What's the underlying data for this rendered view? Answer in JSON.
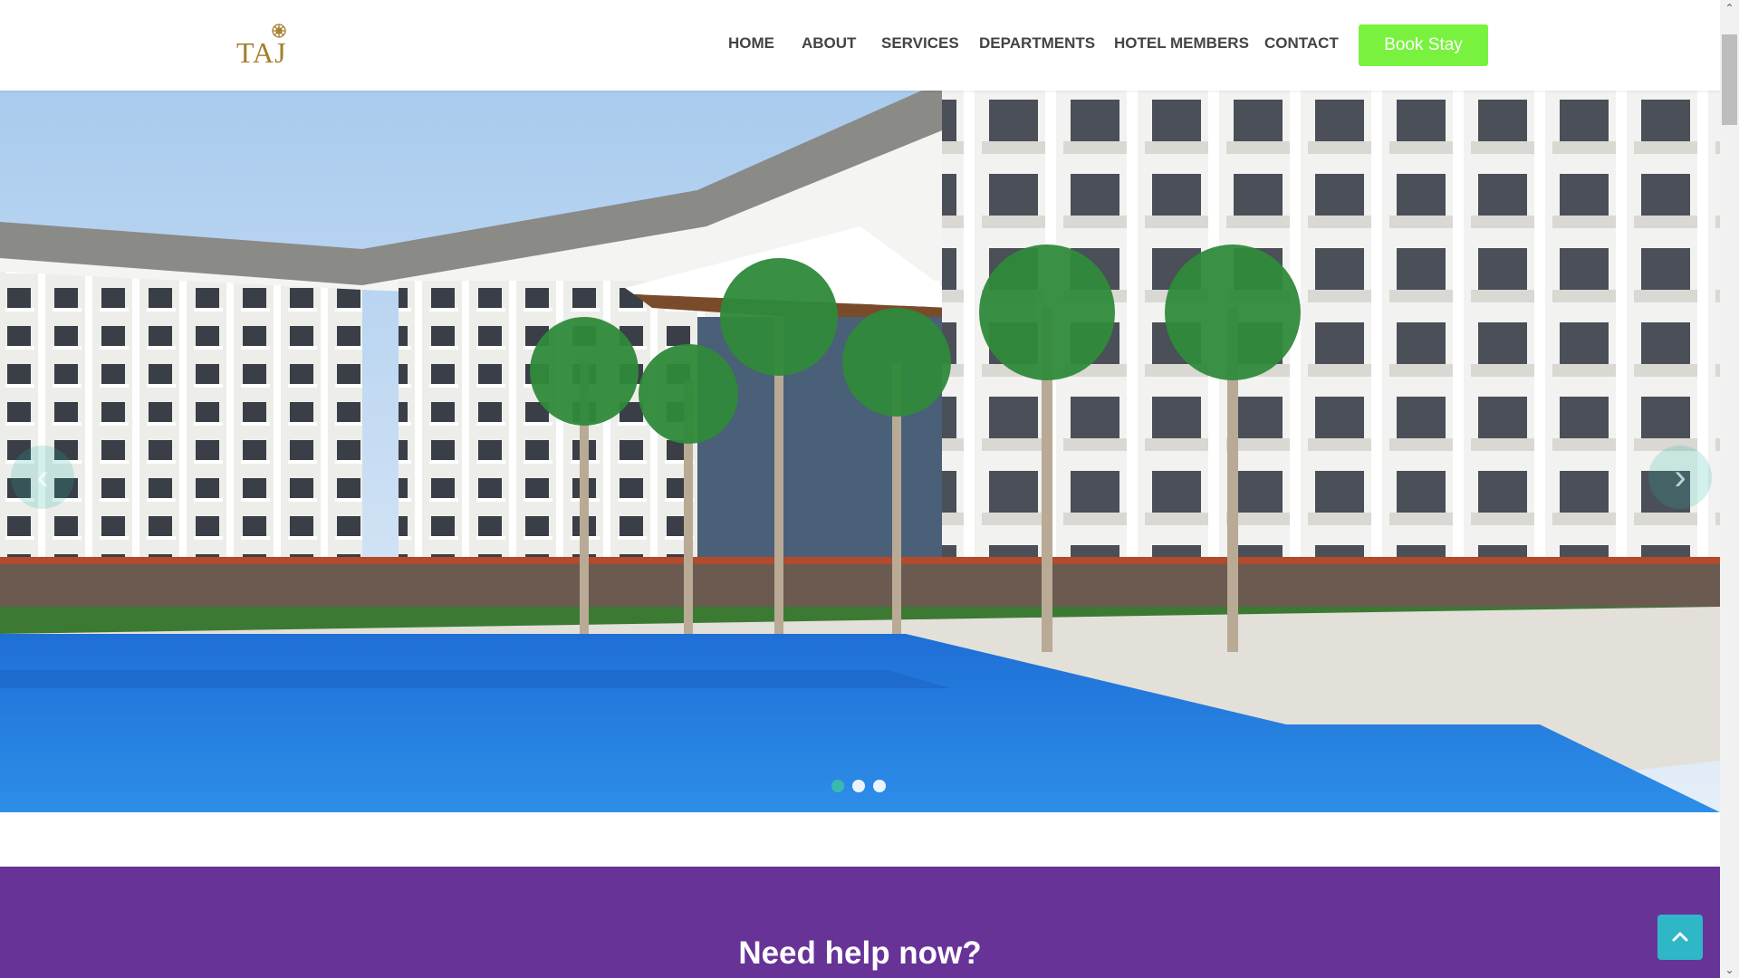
{
  "brand": {
    "logo_text": "TAJ",
    "color": "#a47e2c"
  },
  "nav": {
    "items": [
      {
        "label": "HOME"
      },
      {
        "label": "ABOUT"
      },
      {
        "label": "SERVICES"
      },
      {
        "label": "DEPARTMENTS"
      },
      {
        "label": "HOTEL MEMBERS"
      },
      {
        "label": "CONTACT"
      }
    ],
    "cta_label": "Book Stay",
    "cta_color": "#79f23f"
  },
  "hero": {
    "slide_count": 3,
    "active_slide": 1,
    "prev_icon": "chevron-left-icon",
    "next_icon": "chevron-right-icon"
  },
  "help": {
    "title": "Need help now?",
    "background": "#673397"
  },
  "back_to_top": {
    "icon": "chevron-up-icon",
    "color": "#30b7c7"
  },
  "scrollbar": {
    "up_icon": "scroll-up-icon",
    "down_icon": "scroll-down-icon"
  }
}
